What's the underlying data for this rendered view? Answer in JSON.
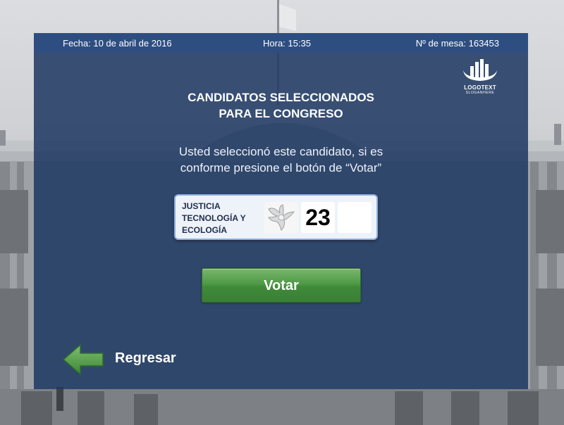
{
  "header": {
    "fecha": "Fecha: 10 de abril de 2016",
    "hora": "Hora: 15:35",
    "mesa": "Nº de mesa: 163453"
  },
  "logo": {
    "text": "LOGOTEXT",
    "slogan": "SLOGANHERE",
    "icon": "bar-chart-logo-icon"
  },
  "title": {
    "line1": "CANDIDATOS SELECCIONADOS",
    "line2": "PARA EL CONGRESO"
  },
  "instruction": {
    "line1": "Usted seleccionó este candidato, si es",
    "line2": "conforme presione el botón de “Votar”"
  },
  "candidate": {
    "party_lines": [
      "JUSTICIA",
      "TECNOLOGÍA Y",
      "ECOLOGÍA"
    ],
    "party_icon": "dove-icon",
    "number": "23",
    "preference": ""
  },
  "actions": {
    "votar_label": "Votar",
    "regresar_label": "Regresar",
    "regresar_icon": "arrow-left-icon"
  },
  "colors": {
    "panel": "#1e3862",
    "topbar": "#2e4e82",
    "button_green": "#4f9a47",
    "arrow_green": "#5fa055"
  }
}
